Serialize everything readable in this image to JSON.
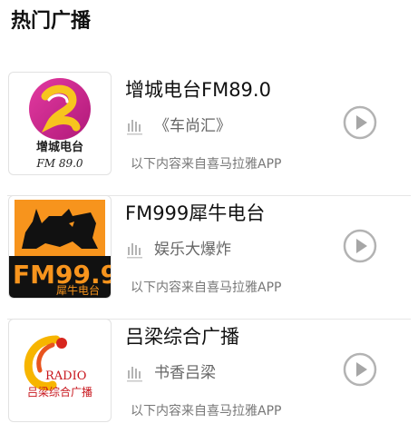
{
  "section": {
    "title": "热门广播"
  },
  "colors": {
    "divider": "#e6e6e6",
    "icon_gray": "#b3b3b3",
    "text_secondary": "#666666"
  },
  "stations": [
    {
      "name": "增城电台FM89.0",
      "episode": "《车尚汇》",
      "source": "以下内容来自喜马拉雅APP",
      "logo": {
        "line1": "增城电台",
        "line2": "FM 89.0"
      },
      "live_icon": "live-bars-icon",
      "play_icon": "play-circle-icon"
    },
    {
      "name": "FM999犀牛电台",
      "episode": "娱乐大爆炸",
      "source": "以下内容来自喜马拉雅APP",
      "logo": {
        "line1": "FM99.9",
        "line2": "犀牛电台"
      },
      "live_icon": "live-bars-icon",
      "play_icon": "play-circle-icon"
    },
    {
      "name": "吕梁综合广播",
      "episode": "书香吕梁",
      "source": "以下内容来自喜马拉雅APP",
      "logo": {
        "line1": "RADIO",
        "line2": "吕梁综合广播"
      },
      "live_icon": "live-bars-icon",
      "play_icon": "play-circle-icon"
    }
  ]
}
